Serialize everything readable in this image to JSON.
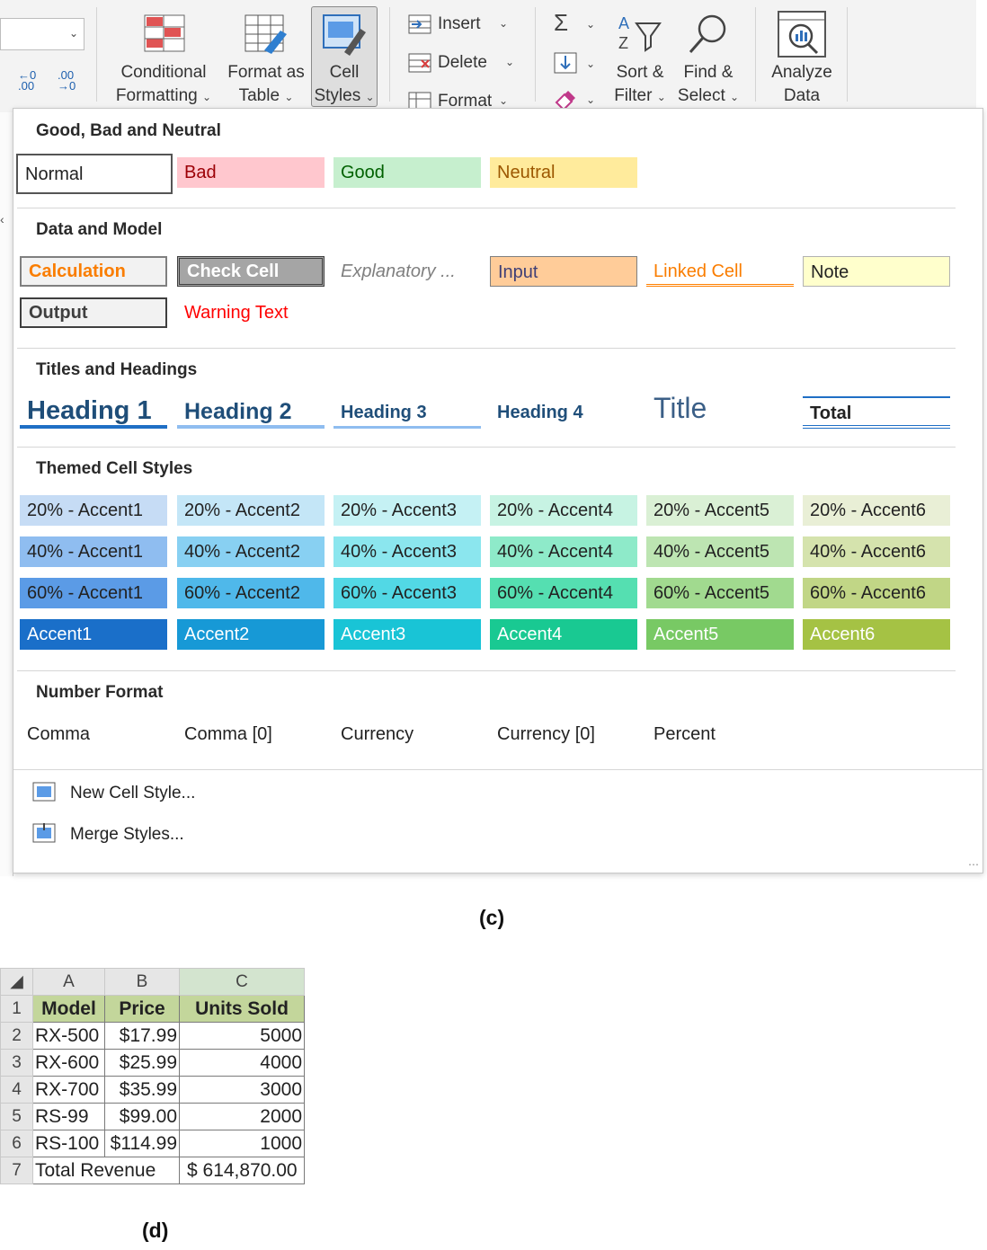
{
  "ribbon": {
    "conditional_formatting": [
      "Conditional",
      "Formatting"
    ],
    "format_as_table": [
      "Format as",
      "Table"
    ],
    "cell_styles": [
      "Cell",
      "Styles"
    ],
    "insert": "Insert",
    "delete": "Delete",
    "format": "Format",
    "sort_filter": [
      "Sort &",
      "Filter"
    ],
    "find_select": [
      "Find &",
      "Select"
    ],
    "analyze_data": [
      "Analyze",
      "Data"
    ]
  },
  "gallery": {
    "good_bad_neutral": {
      "title": "Good, Bad and Neutral",
      "styles": [
        "Normal",
        "Bad",
        "Good",
        "Neutral"
      ]
    },
    "data_model": {
      "title": "Data and Model",
      "styles": [
        "Calculation",
        "Check Cell",
        "Explanatory ...",
        "Input",
        "Linked Cell",
        "Note",
        "Output",
        "Warning Text"
      ]
    },
    "titles_headings": {
      "title": "Titles and Headings",
      "styles": [
        "Heading 1",
        "Heading 2",
        "Heading 3",
        "Heading 4",
        "Title",
        "Total"
      ]
    },
    "themed": {
      "title": "Themed Cell Styles",
      "rows": [
        [
          "20% - Accent1",
          "20% - Accent2",
          "20% - Accent3",
          "20% - Accent4",
          "20% - Accent5",
          "20% - Accent6"
        ],
        [
          "40% - Accent1",
          "40% - Accent2",
          "40% - Accent3",
          "40% - Accent4",
          "40% - Accent5",
          "40% - Accent6"
        ],
        [
          "60% - Accent1",
          "60% - Accent2",
          "60% - Accent3",
          "60% - Accent4",
          "60% - Accent5",
          "60% - Accent6"
        ],
        [
          "Accent1",
          "Accent2",
          "Accent3",
          "Accent4",
          "Accent5",
          "Accent6"
        ]
      ],
      "colors": [
        [
          "#c6dcf5",
          "#c4e6f7",
          "#c5f1f4",
          "#c7f3e3",
          "#daf0d5",
          "#e9efd6"
        ],
        [
          "#8fbdf0",
          "#88d0f2",
          "#8be6ee",
          "#8eeac9",
          "#bde5b2",
          "#d5e3ad"
        ],
        [
          "#5b9be6",
          "#4fb8ea",
          "#52d8e5",
          "#55dfb1",
          "#a1da8f",
          "#c1d686"
        ],
        [
          "#1a6fc9",
          "#1799d6",
          "#19c4d6",
          "#19c992",
          "#78c964",
          "#a5c244"
        ]
      ]
    },
    "number_format": {
      "title": "Number Format",
      "styles": [
        "Comma",
        "Comma [0]",
        "Currency",
        "Currency [0]",
        "Percent"
      ]
    },
    "menu": {
      "new_cell_style": "New Cell Style...",
      "merge_styles": "Merge Styles..."
    }
  },
  "caption_c": "(c)",
  "caption_d": "(d)",
  "spreadsheet": {
    "columns": [
      "A",
      "B",
      "C"
    ],
    "row_numbers": [
      "1",
      "2",
      "3",
      "4",
      "5",
      "6",
      "7"
    ],
    "headers": [
      "Model",
      "Price",
      "Units Sold"
    ],
    "rows": [
      [
        "RX-500",
        "$17.99",
        "5000"
      ],
      [
        "RX-600",
        "$25.99",
        "4000"
      ],
      [
        "RX-700",
        "$35.99",
        "3000"
      ],
      [
        "RS-99",
        "$99.00",
        "2000"
      ],
      [
        "RS-100",
        "$114.99",
        "1000"
      ]
    ],
    "total_label": "Total Revenue",
    "total_value": "$ 614,870.00"
  }
}
